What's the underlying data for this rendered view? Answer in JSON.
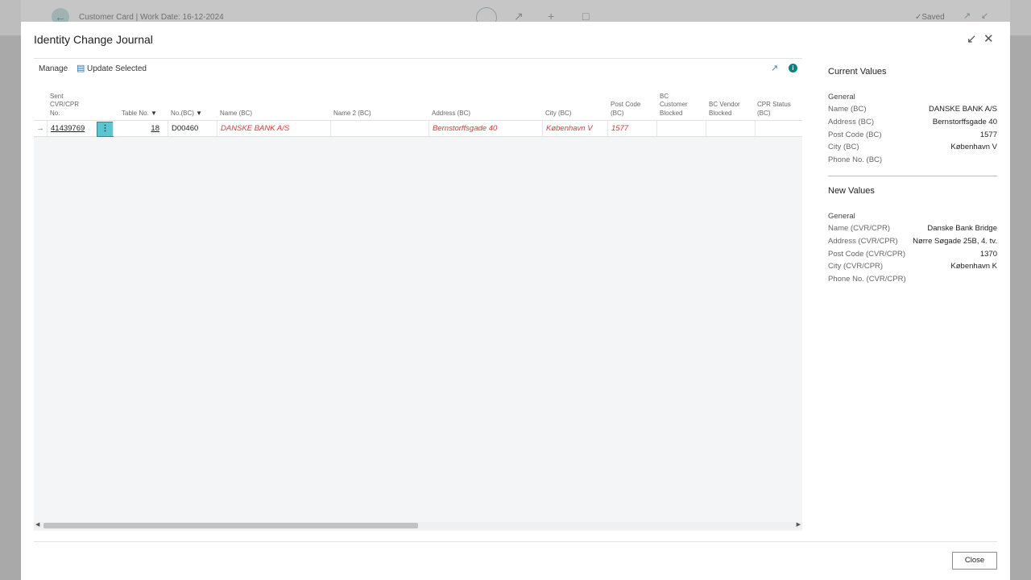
{
  "background": {
    "title": "Customer Card | Work Date: 16-12-2024",
    "saved": "Saved"
  },
  "dialog": {
    "title": "Identity Change Journal",
    "actions": {
      "manage": "Manage",
      "update_selected": "Update Selected"
    },
    "columns": [
      "Sent CVR/CPR No.",
      "Table No.",
      "No.(BC)",
      "Name (BC)",
      "Name 2 (BC)",
      "Address (BC)",
      "City (BC)",
      "Post Code (BC)",
      "BC Customer Blocked",
      "BC Vendor Blocked",
      "CPR Status (BC)"
    ],
    "header_lines": {
      "sent1": "Sent",
      "sent2": "CVR/CPR",
      "sent3": "No.",
      "table_no": "Table No.",
      "no_bc": "No.(BC)",
      "name_bc": "Name (BC)",
      "name2_bc": "Name 2 (BC)",
      "address_bc": "Address (BC)",
      "city_bc": "City (BC)",
      "postcode1": "Post Code",
      "postcode2": "(BC)",
      "cust1": "BC",
      "cust2": "Customer",
      "cust3": "Blocked",
      "vend1": "BC Vendor",
      "vend2": "Blocked",
      "cpr1": "CPR Status",
      "cpr2": "(BC)"
    },
    "rows": [
      {
        "sent_cvr": "41439769",
        "table_no": "18",
        "no_bc": "D00460",
        "name_bc": "DANSKE BANK A/S",
        "name2_bc": "",
        "address_bc": "Bernstorffsgade 40",
        "city_bc": "København V",
        "post_code_bc": "1577",
        "bc_customer_blocked": "",
        "bc_vendor_blocked": "",
        "cpr_status_bc": ""
      }
    ],
    "close_label": "Close"
  },
  "factbox": {
    "current": {
      "heading": "Current Values",
      "group": "General",
      "fields": [
        {
          "label": "Name (BC)",
          "value": "DANSKE BANK A/S"
        },
        {
          "label": "Address (BC)",
          "value": "Bernstorffsgade 40"
        },
        {
          "label": "Post Code (BC)",
          "value": "1577"
        },
        {
          "label": "City (BC)",
          "value": "København V"
        },
        {
          "label": "Phone No. (BC)",
          "value": ""
        }
      ]
    },
    "new": {
      "heading": "New Values",
      "group": "General",
      "fields": [
        {
          "label": "Name (CVR/CPR)",
          "value": "Danske Bank Bridge"
        },
        {
          "label": "Address (CVR/CPR)",
          "value": "Nørre Søgade 25B, 4. tv."
        },
        {
          "label": "Post Code (CVR/CPR)",
          "value": "1370"
        },
        {
          "label": "City (CVR/CPR)",
          "value": "København K"
        },
        {
          "label": "Phone No. (CVR/CPR)",
          "value": ""
        }
      ]
    }
  },
  "colors": {
    "accent": "#008489",
    "error_text": "#d43b3b",
    "selected_cell": "#5bc5d0"
  },
  "icons": [
    "back-arrow-icon",
    "edit-icon",
    "share-icon",
    "plus-icon",
    "delete-icon",
    "check-icon",
    "open-new-icon",
    "collapse-icon",
    "minimize-icon",
    "close-icon",
    "update-icon",
    "info-icon",
    "row-arrow-icon",
    "more-options-icon",
    "filter-icon"
  ]
}
